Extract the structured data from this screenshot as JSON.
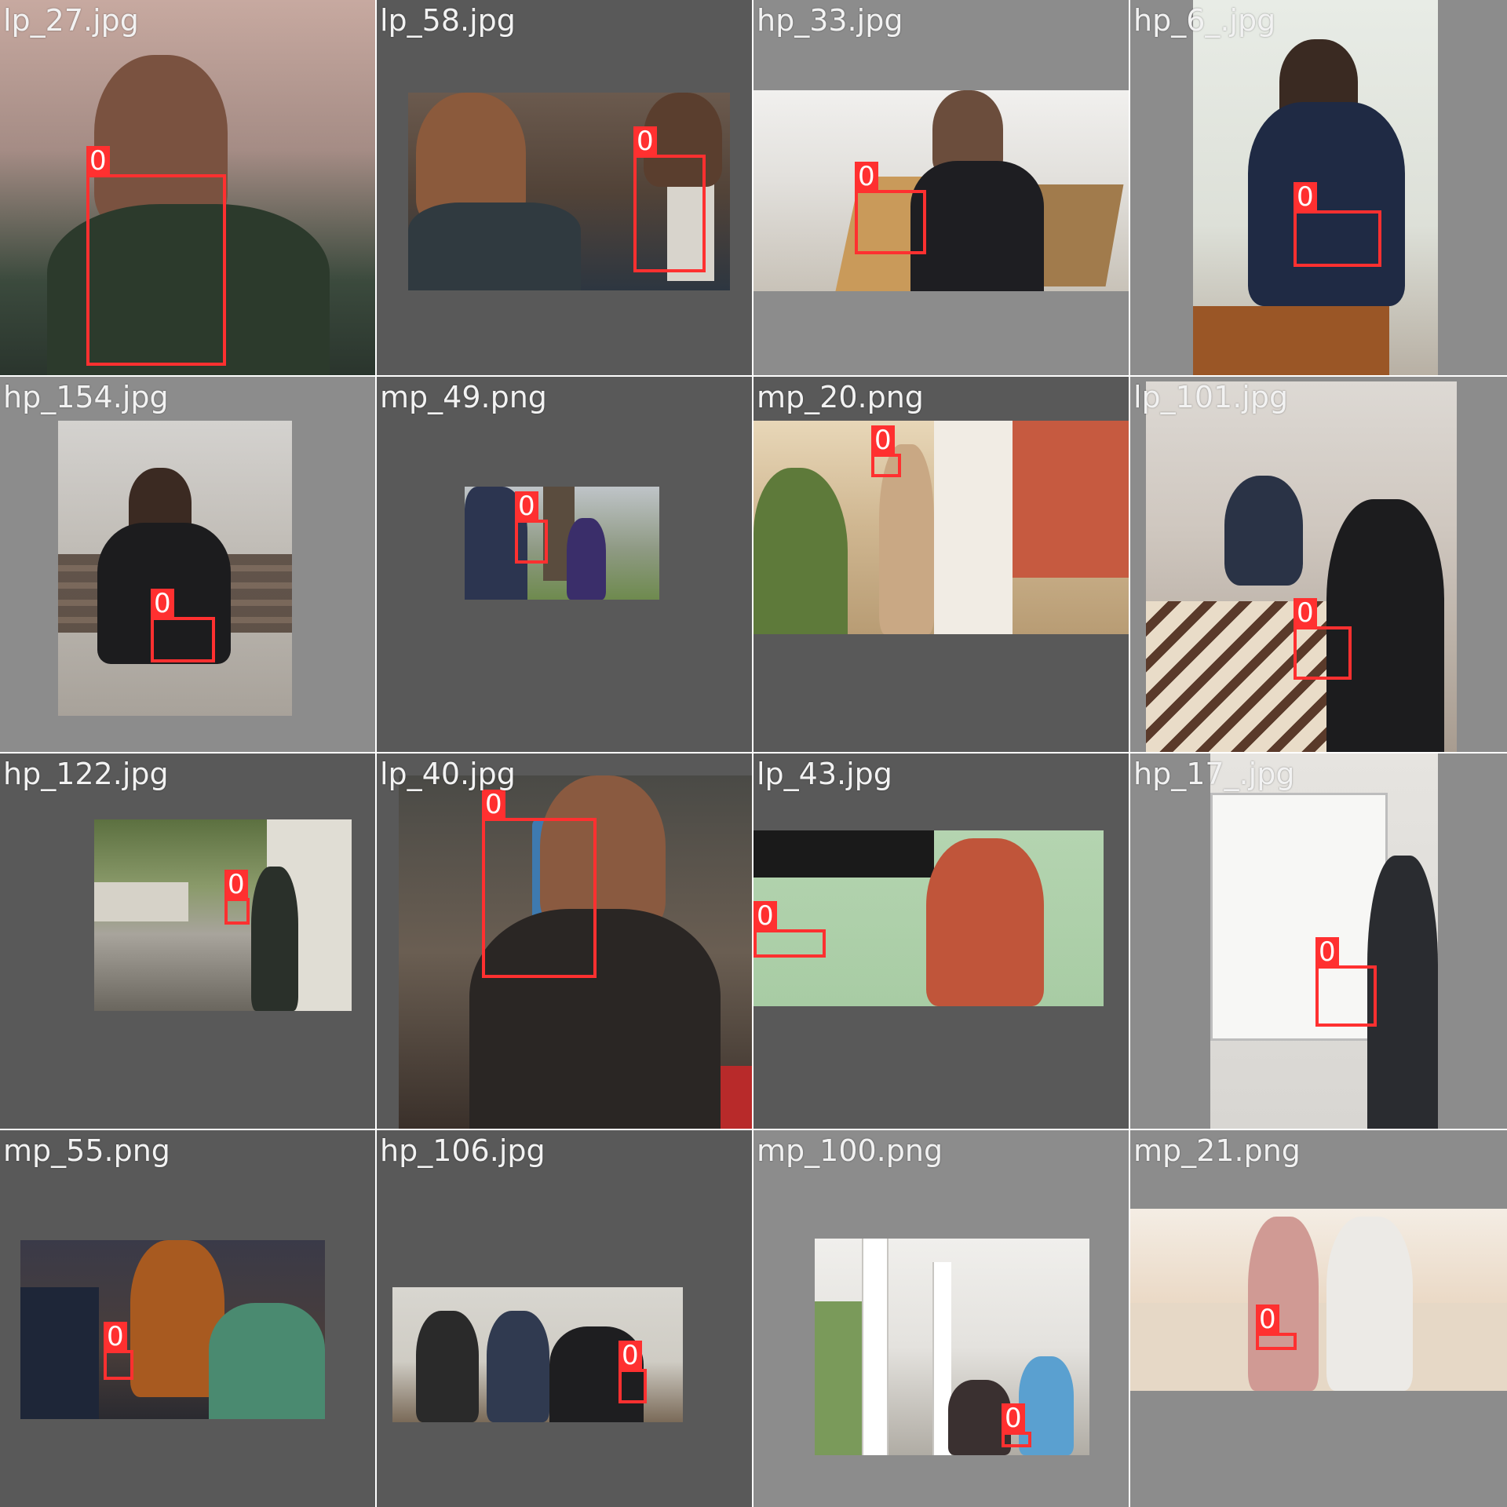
{
  "tiles": [
    {
      "filename": "lp_27.jpg",
      "label": "0"
    },
    {
      "filename": "lp_58.jpg",
      "label": "0"
    },
    {
      "filename": "hp_33.jpg",
      "label": "0"
    },
    {
      "filename": "hp_6_.jpg",
      "label": "0"
    },
    {
      "filename": "hp_154.jpg",
      "label": "0"
    },
    {
      "filename": "mp_49.png",
      "label": "0"
    },
    {
      "filename": "mp_20.png",
      "label": "0"
    },
    {
      "filename": "lp_101.jpg",
      "label": "0"
    },
    {
      "filename": "hp_122.jpg",
      "label": "0"
    },
    {
      "filename": "lp_40.jpg",
      "label": "0"
    },
    {
      "filename": "lp_43.jpg",
      "label": "0"
    },
    {
      "filename": "hp_17_.jpg",
      "label": "0"
    },
    {
      "filename": "mp_55.png",
      "label": "0"
    },
    {
      "filename": "hp_106.jpg",
      "label": "0"
    },
    {
      "filename": "mp_100.png",
      "label": "0"
    },
    {
      "filename": "mp_21.png",
      "label": "0"
    }
  ],
  "colors": {
    "box": "#ff3030",
    "pad_mid": "#8c8c8c",
    "pad_dark": "#595959",
    "divider": "#ffffff"
  }
}
